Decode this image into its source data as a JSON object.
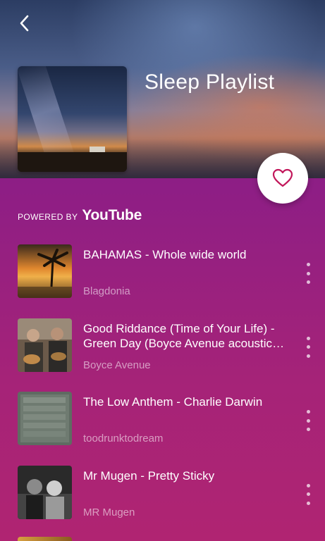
{
  "header": {
    "back_icon": "chevron-left-icon",
    "playlist_title": "Sleep Playlist",
    "favorite_icon": "heart-outline-icon"
  },
  "powered_by": {
    "prefix": "POWERED BY",
    "brand": "YouTube"
  },
  "tracks": [
    {
      "title": "BAHAMAS - Whole wide world",
      "artist": "Blagdonia"
    },
    {
      "title": "Good Riddance (Time of Your Life) - Green Day (Boyce Avenue acoustic cover)",
      "artist": "Boyce Avenue"
    },
    {
      "title": "The Low Anthem  - Charlie Darwin",
      "artist": "toodrunktodream"
    },
    {
      "title": "Mr Mugen - Pretty Sticky",
      "artist": "MR Mugen"
    }
  ],
  "colors": {
    "accent_heart": "#c2185b",
    "background_top": "#7a1a86",
    "background_bottom": "#b02472"
  }
}
